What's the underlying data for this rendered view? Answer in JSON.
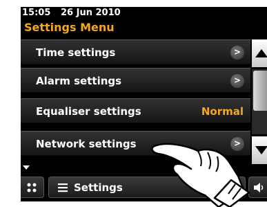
{
  "status": {
    "time": "15:05",
    "date": "26 Jun 2010"
  },
  "title": "Settings Menu",
  "menu": [
    {
      "label": "Time settings",
      "value": "",
      "chevron": ">"
    },
    {
      "label": "Alarm settings",
      "value": "",
      "chevron": ">"
    },
    {
      "label": "Equaliser settings",
      "value": "Normal",
      "chevron": ""
    },
    {
      "label": "Network settings",
      "value": "",
      "chevron": ">"
    }
  ],
  "bottom_bar": {
    "menu_label": "Settings",
    "back_glyph": "<"
  },
  "colors": {
    "accent": "#f4a81d",
    "background": "#000000",
    "text": "#ffffff"
  }
}
